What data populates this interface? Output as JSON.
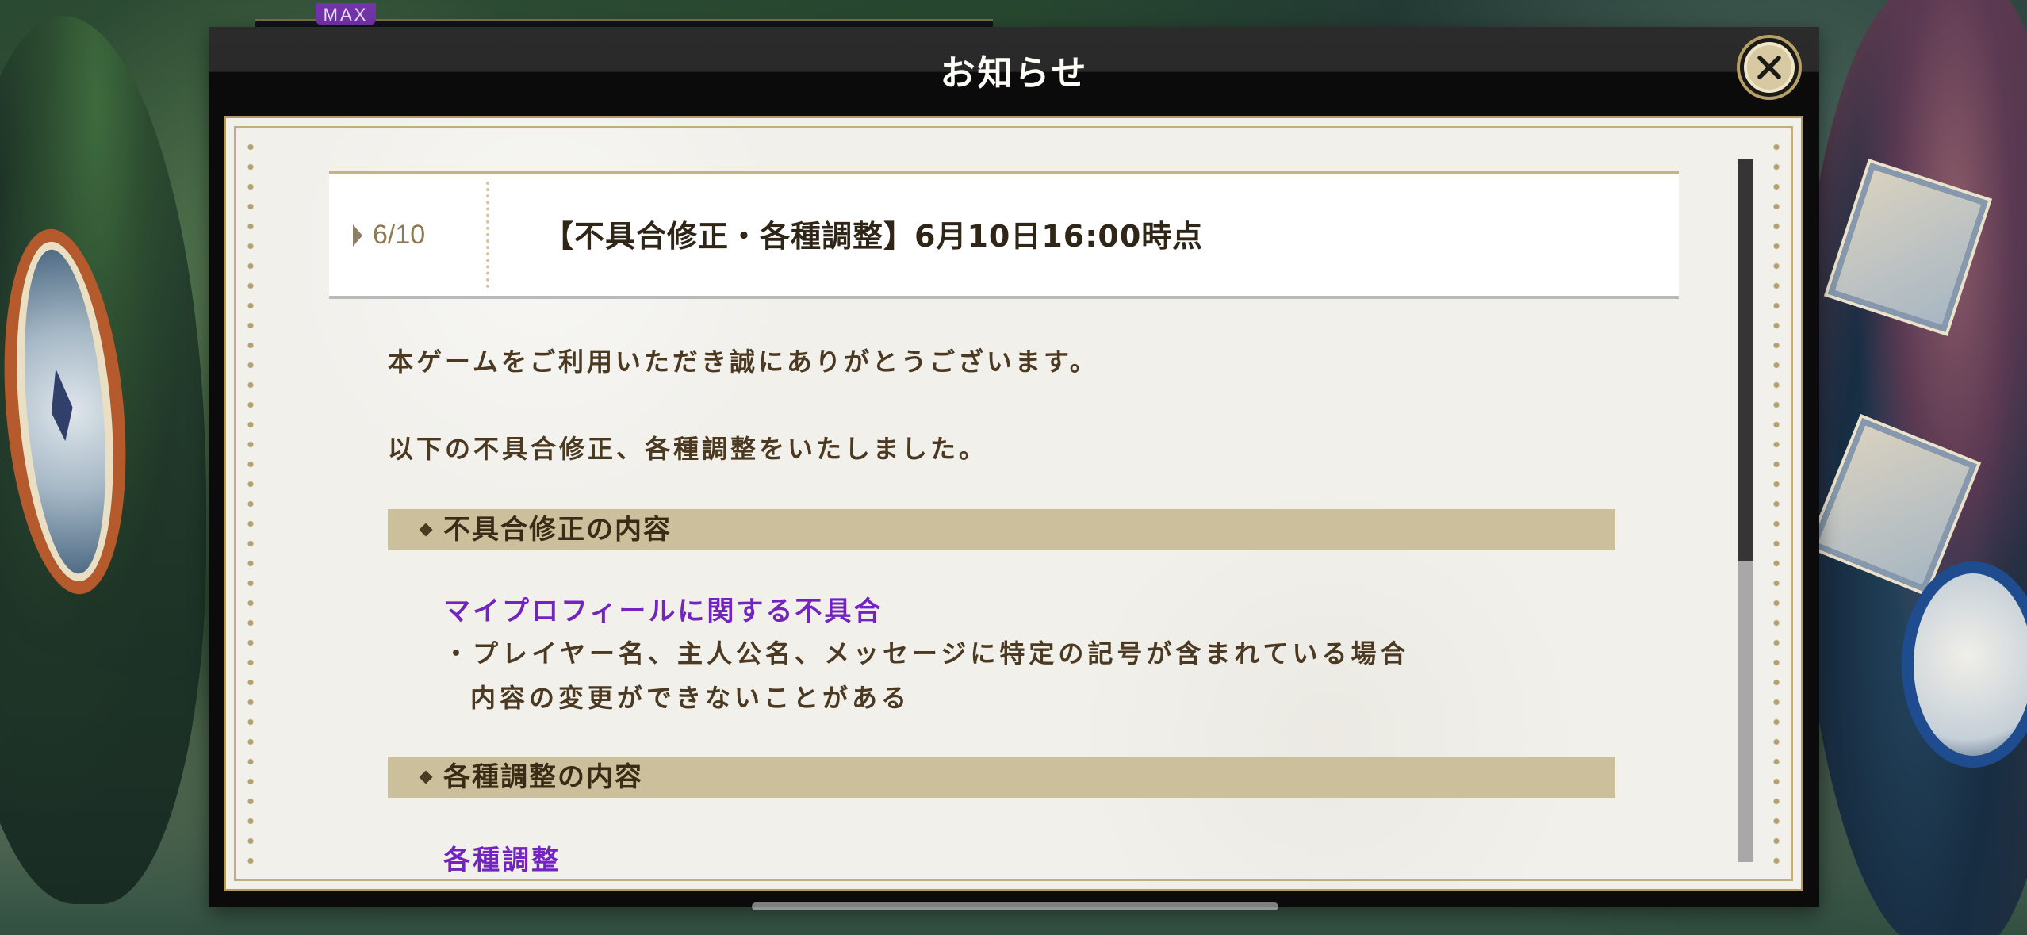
{
  "background": {
    "badge": "MAX",
    "colors": {
      "forest": "#2c4b33",
      "accent_purple": "#7235a8",
      "compass_orange": "#b55a2d",
      "clock_blue": "#1e4c8e"
    }
  },
  "dialog": {
    "title": "お知らせ",
    "close_icon": "close-icon",
    "notice": {
      "date": "6/10",
      "title": "【不具合修正・各種調整】6月10日16:00時点"
    },
    "body": {
      "greeting": "本ゲームをご利用いただき誠にありがとうございます。",
      "intro": "以下の不具合修正、各種調整をいたしました。",
      "sections": [
        {
          "heading": "不具合修正の内容",
          "items": [
            {
              "title": "マイプロフィールに関する不具合",
              "lines": [
                "・プレイヤー名、主人公名、メッセージに特定の記号が含まれている場合",
                "内容の変更ができないことがある"
              ]
            }
          ]
        },
        {
          "heading": "各種調整の内容",
          "items": [
            {
              "title": "各種調整"
            }
          ]
        }
      ]
    },
    "colors": {
      "paper": "#f1f0eb",
      "gold_border": "#b29a66",
      "section_band": "#cbc09b",
      "purple_heading": "#7323bf",
      "body_text": "#4b3a21"
    }
  }
}
